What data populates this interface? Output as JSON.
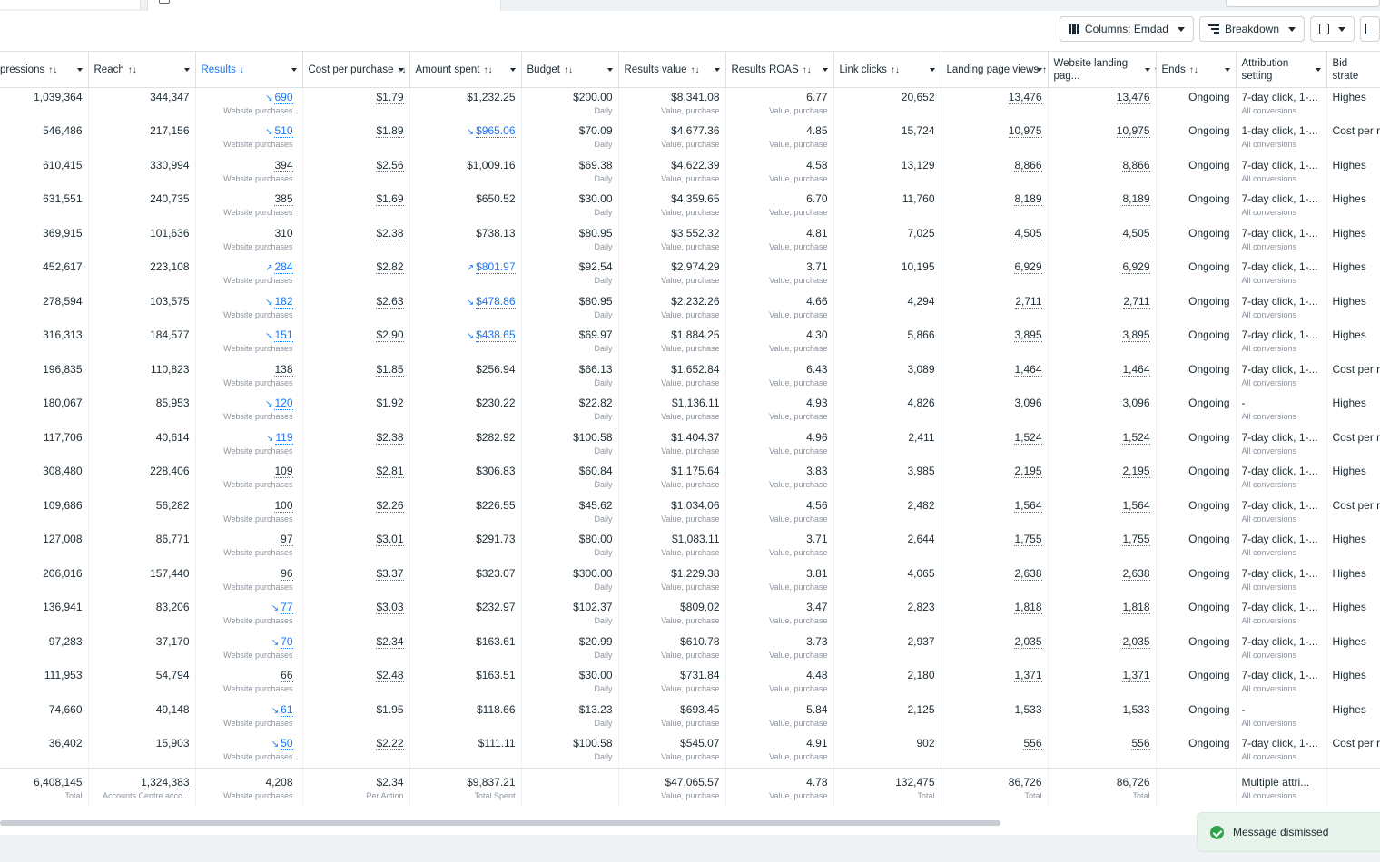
{
  "toolbar": {
    "columns_label": "Columns: Emdad",
    "breakdown_label": "Breakdown"
  },
  "columns": [
    {
      "label": "pressions",
      "sort": "↑↓"
    },
    {
      "label": "Reach",
      "sort": "↑↓"
    },
    {
      "label": "Results",
      "sort": "↓"
    },
    {
      "label": "Cost per purchase",
      "sort": "↑↓"
    },
    {
      "label": "Amount spent",
      "sort": "↑↓"
    },
    {
      "label": "Budget",
      "sort": "↑↓"
    },
    {
      "label": "Results value",
      "sort": "↑↓"
    },
    {
      "label": "Results ROAS",
      "sort": "↑↓"
    },
    {
      "label": "Link clicks",
      "sort": "↑↓"
    },
    {
      "label": "Landing page views",
      "sort": "↑↓"
    },
    {
      "label": "Website landing pag...",
      "sort": "↑↓"
    },
    {
      "label": "Ends",
      "sort": "↑↓"
    },
    {
      "label": "Attribution setting",
      "sort": ""
    },
    {
      "label": "Bid strate",
      "sort": ""
    }
  ],
  "labels": {
    "website_purchases": "Website purchases",
    "daily": "Daily",
    "value_purchase": "Value, purchase",
    "all_conversions": "All conversions"
  },
  "rows": [
    {
      "impressions": "1,039,364",
      "reach": "344,347",
      "results": "690",
      "results_trend": "down",
      "cpp": "$1.79",
      "cpp_link": true,
      "spent": "$1,232.25",
      "spent_trend": "",
      "budget": "$200.00",
      "value": "$8,341.08",
      "roas": "6.77",
      "clicks": "20,652",
      "lpv": "13,476",
      "lpv_link": true,
      "wlp": "13,476",
      "ends": "Ongoing",
      "attr": "7-day click, 1-...",
      "bid": "Highes"
    },
    {
      "impressions": "546,486",
      "reach": "217,156",
      "results": "510",
      "results_trend": "down",
      "cpp": "$1.89",
      "cpp_link": true,
      "spent": "$965.06",
      "spent_trend": "down",
      "budget": "$70.09",
      "value": "$4,677.36",
      "roas": "4.85",
      "clicks": "15,724",
      "lpv": "10,975",
      "lpv_link": true,
      "wlp": "10,975",
      "ends": "Ongoing",
      "attr": "1-day click, 1-...",
      "bid": "Cost per r"
    },
    {
      "impressions": "610,415",
      "reach": "330,994",
      "results": "394",
      "results_trend": "",
      "cpp": "$2.56",
      "cpp_link": true,
      "spent": "$1,009.16",
      "spent_trend": "",
      "budget": "$69.38",
      "value": "$4,622.39",
      "roas": "4.58",
      "clicks": "13,129",
      "lpv": "8,866",
      "lpv_link": true,
      "wlp": "8,866",
      "ends": "Ongoing",
      "attr": "7-day click, 1-...",
      "bid": "Highes"
    },
    {
      "impressions": "631,551",
      "reach": "240,735",
      "results": "385",
      "results_trend": "",
      "cpp": "$1.69",
      "cpp_link": true,
      "spent": "$650.52",
      "spent_trend": "",
      "budget": "$30.00",
      "value": "$4,359.65",
      "roas": "6.70",
      "clicks": "11,760",
      "lpv": "8,189",
      "lpv_link": true,
      "wlp": "8,189",
      "ends": "Ongoing",
      "attr": "7-day click, 1-...",
      "bid": "Highes"
    },
    {
      "impressions": "369,915",
      "reach": "101,636",
      "results": "310",
      "results_trend": "",
      "cpp": "$2.38",
      "cpp_link": true,
      "spent": "$738.13",
      "spent_trend": "",
      "budget": "$80.95",
      "value": "$3,552.32",
      "roas": "4.81",
      "clicks": "7,025",
      "lpv": "4,505",
      "lpv_link": true,
      "wlp": "4,505",
      "ends": "Ongoing",
      "attr": "7-day click, 1-...",
      "bid": "Highes"
    },
    {
      "impressions": "452,617",
      "reach": "223,108",
      "results": "284",
      "results_trend": "up",
      "cpp": "$2.82",
      "cpp_link": true,
      "spent": "$801.97",
      "spent_trend": "up",
      "budget": "$92.54",
      "value": "$2,974.29",
      "roas": "3.71",
      "clicks": "10,195",
      "lpv": "6,929",
      "lpv_link": true,
      "wlp": "6,929",
      "ends": "Ongoing",
      "attr": "7-day click, 1-...",
      "bid": "Highes"
    },
    {
      "impressions": "278,594",
      "reach": "103,575",
      "results": "182",
      "results_trend": "down",
      "cpp": "$2.63",
      "cpp_link": true,
      "spent": "$478.86",
      "spent_trend": "down",
      "budget": "$80.95",
      "value": "$2,232.26",
      "roas": "4.66",
      "clicks": "4,294",
      "lpv": "2,711",
      "lpv_link": true,
      "wlp": "2,711",
      "ends": "Ongoing",
      "attr": "7-day click, 1-...",
      "bid": "Highes"
    },
    {
      "impressions": "316,313",
      "reach": "184,577",
      "results": "151",
      "results_trend": "down",
      "cpp": "$2.90",
      "cpp_link": true,
      "spent": "$438.65",
      "spent_trend": "down",
      "budget": "$69.97",
      "value": "$1,884.25",
      "roas": "4.30",
      "clicks": "5,866",
      "lpv": "3,895",
      "lpv_link": true,
      "wlp": "3,895",
      "ends": "Ongoing",
      "attr": "7-day click, 1-...",
      "bid": "Highes"
    },
    {
      "impressions": "196,835",
      "reach": "110,823",
      "results": "138",
      "results_trend": "",
      "cpp": "$1.85",
      "cpp_link": true,
      "spent": "$256.94",
      "spent_trend": "",
      "budget": "$66.13",
      "value": "$1,652.84",
      "roas": "6.43",
      "clicks": "3,089",
      "lpv": "1,464",
      "lpv_link": true,
      "wlp": "1,464",
      "ends": "Ongoing",
      "attr": "7-day click, 1-...",
      "bid": "Cost per r"
    },
    {
      "impressions": "180,067",
      "reach": "85,953",
      "results": "120",
      "results_trend": "down",
      "cpp": "$1.92",
      "cpp_link": false,
      "spent": "$230.22",
      "spent_trend": "",
      "budget": "$22.82",
      "value": "$1,136.11",
      "roas": "4.93",
      "clicks": "4,826",
      "lpv": "3,096",
      "lpv_link": false,
      "wlp": "3,096",
      "ends": "Ongoing",
      "attr": "-",
      "bid": "Highes"
    },
    {
      "impressions": "117,706",
      "reach": "40,614",
      "results": "119",
      "results_trend": "down",
      "cpp": "$2.38",
      "cpp_link": true,
      "spent": "$282.92",
      "spent_trend": "",
      "budget": "$100.58",
      "value": "$1,404.37",
      "roas": "4.96",
      "clicks": "2,411",
      "lpv": "1,524",
      "lpv_link": true,
      "wlp": "1,524",
      "ends": "Ongoing",
      "attr": "7-day click, 1-...",
      "bid": "Cost per r"
    },
    {
      "impressions": "308,480",
      "reach": "228,406",
      "results": "109",
      "results_trend": "",
      "cpp": "$2.81",
      "cpp_link": true,
      "spent": "$306.83",
      "spent_trend": "",
      "budget": "$60.84",
      "value": "$1,175.64",
      "roas": "3.83",
      "clicks": "3,985",
      "lpv": "2,195",
      "lpv_link": true,
      "wlp": "2,195",
      "ends": "Ongoing",
      "attr": "7-day click, 1-...",
      "bid": "Highes"
    },
    {
      "impressions": "109,686",
      "reach": "56,282",
      "results": "100",
      "results_trend": "",
      "cpp": "$2.26",
      "cpp_link": true,
      "spent": "$226.55",
      "spent_trend": "",
      "budget": "$45.62",
      "value": "$1,034.06",
      "roas": "4.56",
      "clicks": "2,482",
      "lpv": "1,564",
      "lpv_link": true,
      "wlp": "1,564",
      "ends": "Ongoing",
      "attr": "7-day click, 1-...",
      "bid": "Cost per r"
    },
    {
      "impressions": "127,008",
      "reach": "86,771",
      "results": "97",
      "results_trend": "",
      "cpp": "$3.01",
      "cpp_link": true,
      "spent": "$291.73",
      "spent_trend": "",
      "budget": "$80.00",
      "value": "$1,083.11",
      "roas": "3.71",
      "clicks": "2,644",
      "lpv": "1,755",
      "lpv_link": true,
      "wlp": "1,755",
      "ends": "Ongoing",
      "attr": "7-day click, 1-...",
      "bid": "Highes"
    },
    {
      "impressions": "206,016",
      "reach": "157,440",
      "results": "96",
      "results_trend": "",
      "cpp": "$3.37",
      "cpp_link": true,
      "spent": "$323.07",
      "spent_trend": "",
      "budget": "$300.00",
      "value": "$1,229.38",
      "roas": "3.81",
      "clicks": "4,065",
      "lpv": "2,638",
      "lpv_link": true,
      "wlp": "2,638",
      "ends": "Ongoing",
      "attr": "7-day click, 1-...",
      "bid": "Highes"
    },
    {
      "impressions": "136,941",
      "reach": "83,206",
      "results": "77",
      "results_trend": "down",
      "cpp": "$3.03",
      "cpp_link": true,
      "spent": "$232.97",
      "spent_trend": "",
      "budget": "$102.37",
      "value": "$809.02",
      "roas": "3.47",
      "clicks": "2,823",
      "lpv": "1,818",
      "lpv_link": true,
      "wlp": "1,818",
      "ends": "Ongoing",
      "attr": "7-day click, 1-...",
      "bid": "Highes"
    },
    {
      "impressions": "97,283",
      "reach": "37,170",
      "results": "70",
      "results_trend": "down",
      "cpp": "$2.34",
      "cpp_link": true,
      "spent": "$163.61",
      "spent_trend": "",
      "budget": "$20.99",
      "value": "$610.78",
      "roas": "3.73",
      "clicks": "2,937",
      "lpv": "2,035",
      "lpv_link": true,
      "wlp": "2,035",
      "ends": "Ongoing",
      "attr": "7-day click, 1-...",
      "bid": "Highes"
    },
    {
      "impressions": "111,953",
      "reach": "54,794",
      "results": "66",
      "results_trend": "",
      "cpp": "$2.48",
      "cpp_link": true,
      "spent": "$163.51",
      "spent_trend": "",
      "budget": "$30.00",
      "value": "$731.84",
      "roas": "4.48",
      "clicks": "2,180",
      "lpv": "1,371",
      "lpv_link": true,
      "wlp": "1,371",
      "ends": "Ongoing",
      "attr": "7-day click, 1-...",
      "bid": "Highes"
    },
    {
      "impressions": "74,660",
      "reach": "49,148",
      "results": "61",
      "results_trend": "down",
      "cpp": "$1.95",
      "cpp_link": false,
      "spent": "$118.66",
      "spent_trend": "",
      "budget": "$13.23",
      "value": "$693.45",
      "roas": "5.84",
      "clicks": "2,125",
      "lpv": "1,533",
      "lpv_link": false,
      "wlp": "1,533",
      "ends": "Ongoing",
      "attr": "-",
      "bid": "Highes"
    },
    {
      "impressions": "36,402",
      "reach": "15,903",
      "results": "50",
      "results_trend": "down",
      "cpp": "$2.22",
      "cpp_link": true,
      "spent": "$111.11",
      "spent_trend": "",
      "budget": "$100.58",
      "value": "$545.07",
      "roas": "4.91",
      "clicks": "902",
      "lpv": "556",
      "lpv_link": true,
      "wlp": "556",
      "ends": "Ongoing",
      "attr": "7-day click, 1-...",
      "bid": "Cost per r"
    }
  ],
  "totals": {
    "impressions": "6,408,145",
    "impressions_sub": "Total",
    "reach": "1,324,383",
    "reach_sub": "Accounts Centre acco...",
    "results": "4,208",
    "results_sub": "Website purchases",
    "cpp": "$2.34",
    "cpp_sub": "Per Action",
    "spent": "$9,837.21",
    "spent_sub": "Total Spent",
    "value": "$47,065.57",
    "value_sub": "Value, purchase",
    "roas": "4.78",
    "roas_sub": "Value, purchase",
    "clicks": "132,475",
    "clicks_sub": "Total",
    "lpv": "86,726",
    "lpv_sub": "Total",
    "wlp": "86,726",
    "wlp_sub": "Total",
    "attr": "Multiple attri...",
    "attr_sub": "All conversions"
  },
  "toast": {
    "message": "Message dismissed"
  },
  "colors": {
    "accent": "#1877f2",
    "success": "#31a24c"
  }
}
